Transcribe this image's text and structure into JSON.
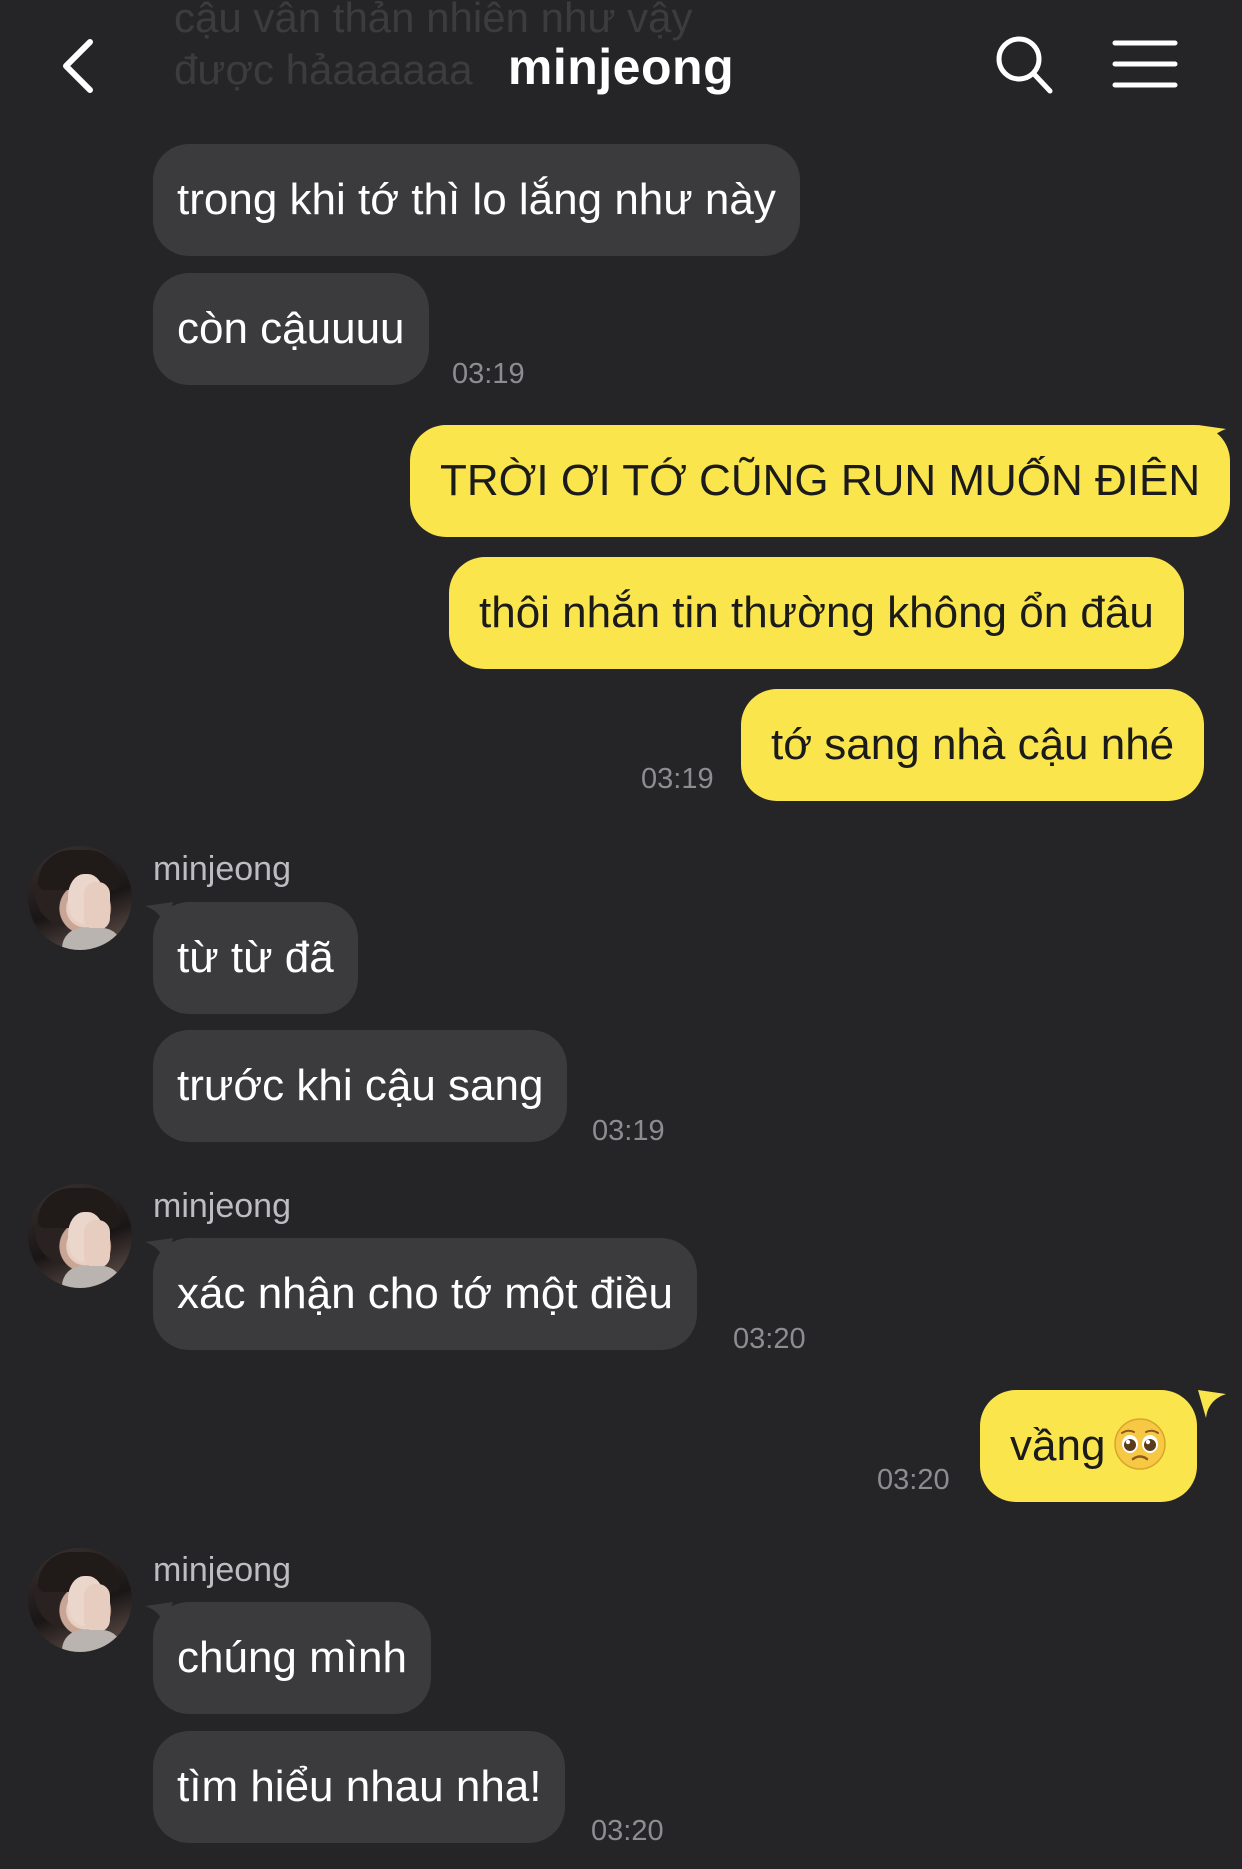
{
  "header": {
    "title": "minjeong",
    "ghost_text": "cậu vẫn thản nhiên như vậy\nđược hảaaaaaa"
  },
  "colors": {
    "background": "#252527",
    "incoming_bubble": "#3b3b3d",
    "outgoing_bubble": "#fbe54d",
    "timestamp": "#8d8d91"
  },
  "icons": {
    "back": "chevron-left-icon",
    "search": "search-icon",
    "menu": "menu-icon",
    "emoji": "pleading-face-emoji"
  },
  "messages": {
    "m1": "trong khi tớ thì lo lắng như này",
    "m2": "còn cậuuuu",
    "t1": "03:19",
    "m3": "TRỜI ƠI TỚ CŨNG RUN MUỐN ĐIÊN",
    "m4": "thôi nhắn tin thường không ổn đâu",
    "m5": "tớ sang nhà cậu nhé",
    "t2": "03:19",
    "sender1": "minjeong",
    "m6": "từ từ đã",
    "m7": "trước khi cậu sang",
    "t3": "03:19",
    "sender2": "minjeong",
    "m8": "xác nhận cho tớ một điều",
    "t4": "03:20",
    "m9": "vầng",
    "t5": "03:20",
    "sender3": "minjeong",
    "m10": "chúng mình",
    "m11": "tìm hiểu nhau nha!",
    "t6": "03:20"
  }
}
